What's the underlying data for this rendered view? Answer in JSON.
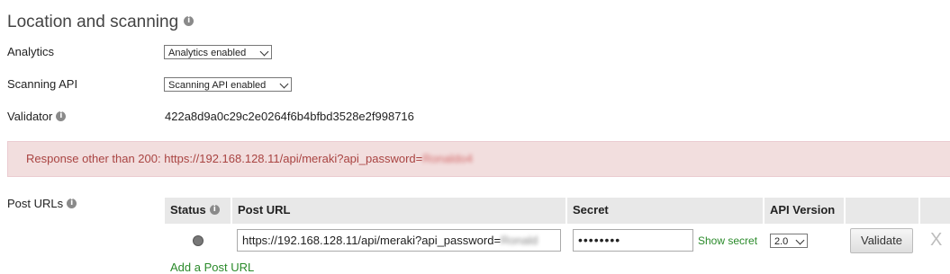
{
  "section": {
    "title": "Location and scanning",
    "analytics_label": "Analytics",
    "analytics_value": "Analytics enabled",
    "scanning_label": "Scanning API",
    "scanning_value": "Scanning API enabled",
    "validator_label": "Validator",
    "validator_value": "422a8d9a0c29c2e0264f6b4bfbd3528e2f998716"
  },
  "alert": {
    "prefix": "Response other than 200: https://192.168.128.11/api/meraki?api_password=",
    "redacted": "Ronaldo4"
  },
  "post_urls": {
    "label": "Post URLs",
    "headers": {
      "status": "Status",
      "post_url": "Post URL",
      "secret": "Secret",
      "api_version": "API Version"
    },
    "row": {
      "url_prefix": "https://192.168.128.11/api/meraki?api_password=",
      "url_redacted": "Ronald",
      "secret_masked": "••••••••",
      "show_secret": "Show secret",
      "api_version": "2.0",
      "validate": "Validate",
      "remove": "X"
    },
    "add_link": "Add a Post URL"
  },
  "icons": {
    "info": "info-icon",
    "dropdown": "chevron-down-icon",
    "status": "status-dot-icon",
    "remove": "close-icon"
  }
}
